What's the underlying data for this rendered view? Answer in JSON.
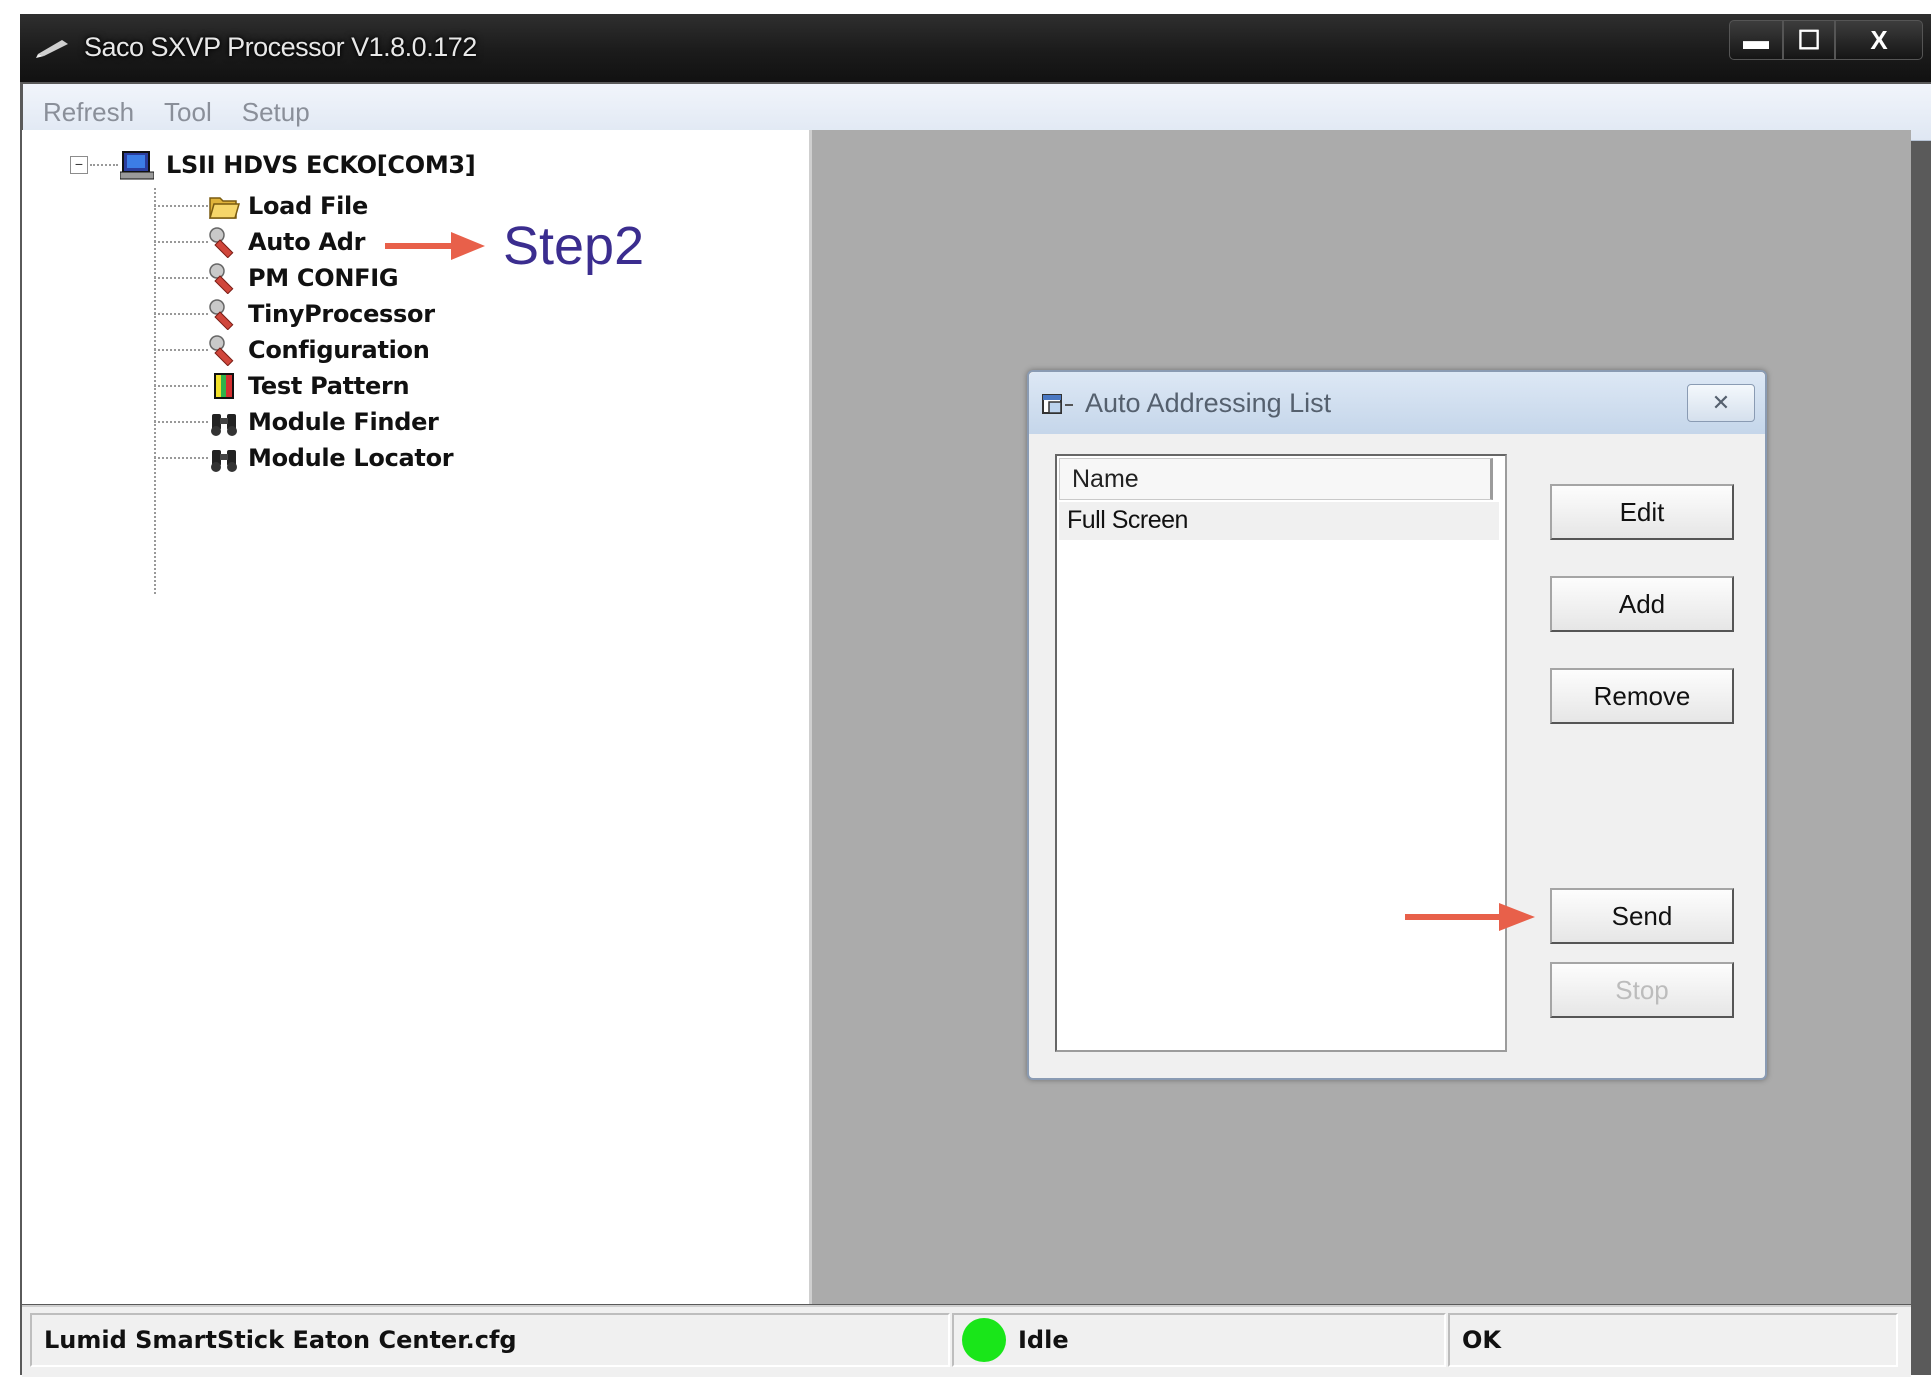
{
  "window": {
    "title": "Saco SXVP Processor  V1.8.0.172",
    "title_icon": "pen-icon",
    "controls": {
      "minimize": "▬",
      "maximize": "☐",
      "close": "X"
    }
  },
  "menu": {
    "items": [
      "Refresh",
      "Tool",
      "Setup"
    ]
  },
  "tree": {
    "root": {
      "label": "LSII HDVS ECKO[COM3]",
      "expander": "−",
      "icon": "computer-icon"
    },
    "children": [
      {
        "label": "Load File",
        "icon": "folder-open-icon"
      },
      {
        "label": "Auto Adr",
        "icon": "wrench-icon"
      },
      {
        "label": "PM CONFIG",
        "icon": "wrench-icon"
      },
      {
        "label": "TinyProcessor",
        "icon": "wrench-icon"
      },
      {
        "label": "Configuration",
        "icon": "wrench-icon"
      },
      {
        "label": "Test Pattern",
        "icon": "color-bars-icon"
      },
      {
        "label": "Module Finder",
        "icon": "binoculars-icon"
      },
      {
        "label": "Module Locator",
        "icon": "binoculars-icon"
      }
    ]
  },
  "annotations": {
    "step_label": "Step2",
    "arrow_color": "#e8604a"
  },
  "dialog": {
    "title": "Auto Addressing List",
    "close_glyph": "✕",
    "list": {
      "header": "Name",
      "rows": [
        "Full Screen"
      ]
    },
    "buttons": {
      "edit": "Edit",
      "add": "Add",
      "remove": "Remove",
      "send": "Send",
      "stop": "Stop"
    }
  },
  "statusbar": {
    "file": "Lumid SmartStick Eaton Center.cfg",
    "state": "Idle",
    "state_color": "#19e619",
    "result": "OK"
  }
}
